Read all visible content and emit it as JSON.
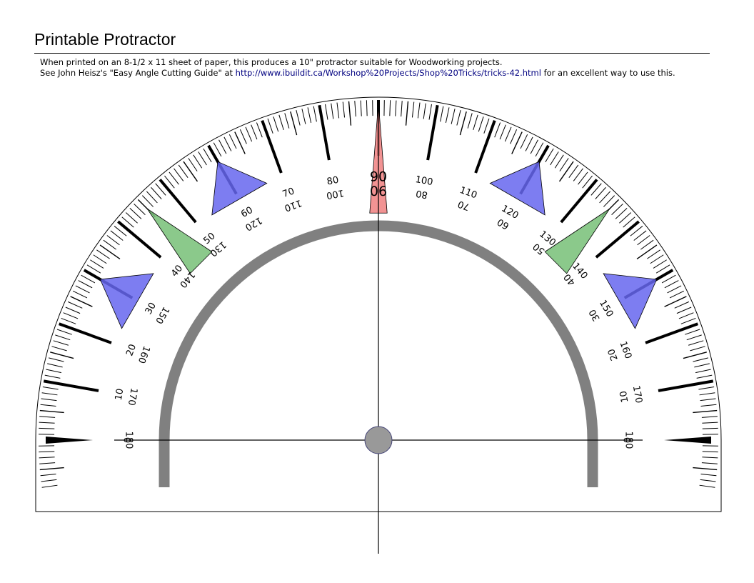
{
  "page": {
    "title": "Printable Protractor",
    "line1": "When printed on an 8-1/2 x 11 sheet of paper, this produces a 10\" protractor suitable for Woodworking projects.",
    "line2_prefix": "See John Heisz's \"Easy Angle Cutting Guide\" at ",
    "line2_link": "http://www.ibuildit.ca/Workshop%20Projects/Shop%20Tricks/tricks-42.html",
    "line2_suffix": " for an excellent way to use this."
  },
  "protractor": {
    "range_degrees": [
      0,
      180
    ],
    "minor_tick_step": 1,
    "mid_tick_step": 5,
    "major_tick_step": 10,
    "outer_scale_labels": [
      "0",
      "10",
      "20",
      "30",
      "40",
      "50",
      "60",
      "70",
      "80",
      "90",
      "100",
      "110",
      "120",
      "130",
      "140",
      "150",
      "160",
      "170",
      "180"
    ],
    "inner_scale_labels": [
      "180",
      "170",
      "160",
      "150",
      "140",
      "130",
      "120",
      "110",
      "100",
      "90",
      "80",
      "70",
      "60",
      "50",
      "40",
      "30",
      "20",
      "10",
      "0"
    ],
    "pointers": [
      {
        "angle": 90,
        "color": "#f08080",
        "kind": "center-marker"
      },
      {
        "angle": 30,
        "color": "#6666ee",
        "kind": "blue-marker"
      },
      {
        "angle": 60,
        "color": "#6666ee",
        "kind": "blue-marker"
      },
      {
        "angle": 120,
        "color": "#6666ee",
        "kind": "blue-marker"
      },
      {
        "angle": 150,
        "color": "#6666ee",
        "kind": "blue-marker"
      },
      {
        "angle": 45,
        "color": "#77c077",
        "kind": "green-marker"
      },
      {
        "angle": 135,
        "color": "#77c077",
        "kind": "green-marker"
      }
    ],
    "inner_arc_color": "#808080",
    "center_dot_color": "#999999"
  }
}
